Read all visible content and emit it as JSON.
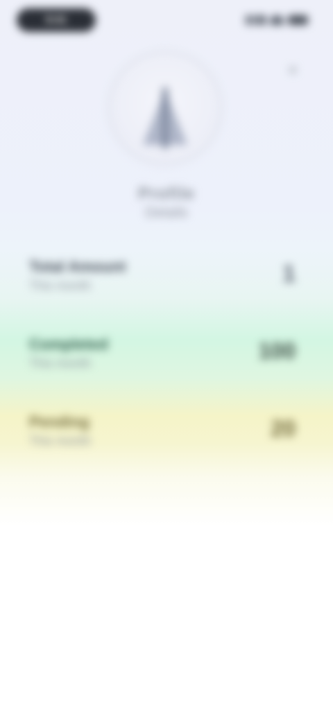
{
  "status_bar": {
    "time": "9:41",
    "signal_icon": "signal-icon",
    "wifi_icon": "wifi-icon",
    "battery_icon": "battery-icon"
  },
  "header": {
    "close_icon": "close-icon",
    "close_glyph": "×"
  },
  "profile": {
    "avatar_icon": "person-icon",
    "name": "Profile",
    "subtitle": "Details"
  },
  "rows": [
    {
      "title": "Total Amount",
      "subtitle": "This month",
      "value": "1"
    },
    {
      "title": "Completed",
      "subtitle": "This month",
      "value": "100"
    },
    {
      "title": "Pending",
      "subtitle": "This month",
      "value": "20"
    }
  ],
  "colors": {
    "status_pill": "#2a2e36",
    "green_band": "#d3f6e3",
    "yellow_band": "#f5f4c8",
    "background": "#eef0f9"
  }
}
